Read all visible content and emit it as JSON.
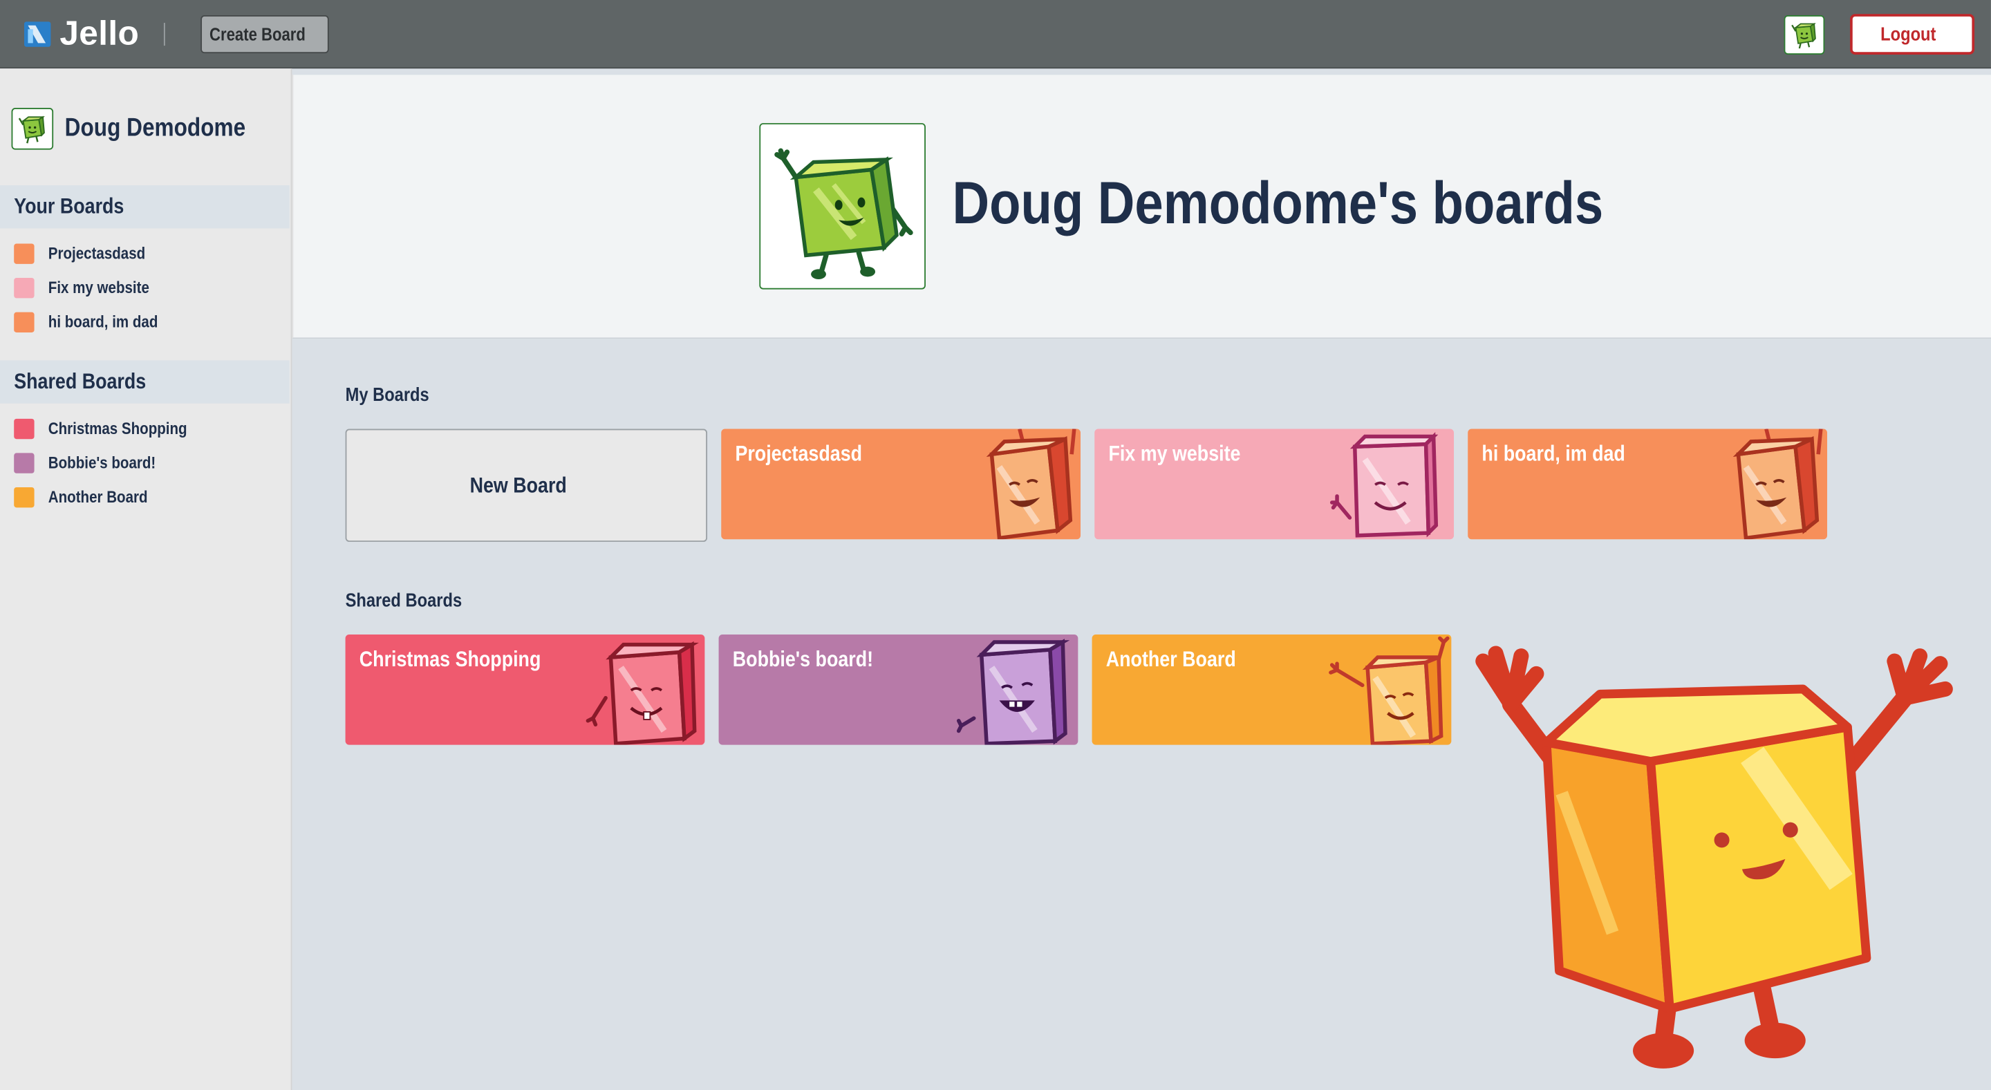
{
  "app": {
    "name": "Jello",
    "create_board_label": "Create Board",
    "logout_label": "Logout"
  },
  "sidebar": {
    "username": "Doug Demodome",
    "your_boards_header": "Your Boards",
    "your_boards": [
      {
        "label": "Projectasdasd",
        "color": "#f78f5a"
      },
      {
        "label": "Fix my website",
        "color": "#f6a9b6"
      },
      {
        "label": "hi board, im dad",
        "color": "#f78f5a"
      }
    ],
    "shared_boards_header": "Shared Boards",
    "shared_boards": [
      {
        "label": "Christmas Shopping",
        "color": "#ef5a6f"
      },
      {
        "label": "Bobbie's board!",
        "color": "#b77aa8"
      },
      {
        "label": "Another Board",
        "color": "#f8a833"
      }
    ]
  },
  "main": {
    "page_title": "Doug Demodome's boards",
    "my_boards_label": "My Boards",
    "new_board_label": "New Board",
    "my_boards": [
      {
        "title": "Projectasdasd",
        "color": "#f78f5a",
        "mascot": "orange-cube-mascot-icon"
      },
      {
        "title": "Fix my website",
        "color": "#f6a9b6",
        "mascot": "pink-cube-mascot-icon"
      },
      {
        "title": "hi board, im dad",
        "color": "#f78f5a",
        "mascot": "orange-cube-mascot-icon"
      }
    ],
    "shared_boards_label": "Shared Boards",
    "shared_boards": [
      {
        "title": "Christmas Shopping",
        "color": "#ef5a6f",
        "mascot": "red-cube-mascot-icon"
      },
      {
        "title": "Bobbie's board!",
        "color": "#b77aa8",
        "mascot": "purple-cube-mascot-icon"
      },
      {
        "title": "Another Board",
        "color": "#f8a833",
        "mascot": "yellow-cube-mascot-icon"
      }
    ]
  },
  "colors": {
    "topbar": "#5f6566",
    "logout": "#c0282b",
    "title_text": "#1f2f4a",
    "background": "#dae0e6"
  }
}
